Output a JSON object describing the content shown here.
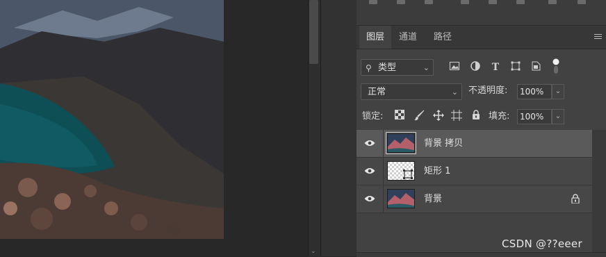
{
  "tabs": [
    "图层",
    "通道",
    "路径"
  ],
  "filter": {
    "kind_label": "类型"
  },
  "blend": {
    "mode": "正常",
    "opacity_label": "不透明度:",
    "opacity_value": "100%"
  },
  "lock": {
    "label": "锁定:",
    "fill_label": "填充:",
    "fill_value": "100%"
  },
  "layers": [
    {
      "name": "背景 拷贝",
      "active": true
    },
    {
      "name": "矩形 1",
      "active": false
    },
    {
      "name": "背景",
      "active": false,
      "locked": true
    }
  ],
  "watermark": "CSDN @??eeer",
  "colors": {
    "panel": "#424242",
    "active_layer": "#5a5a5a",
    "lake": "#0e4f56"
  }
}
